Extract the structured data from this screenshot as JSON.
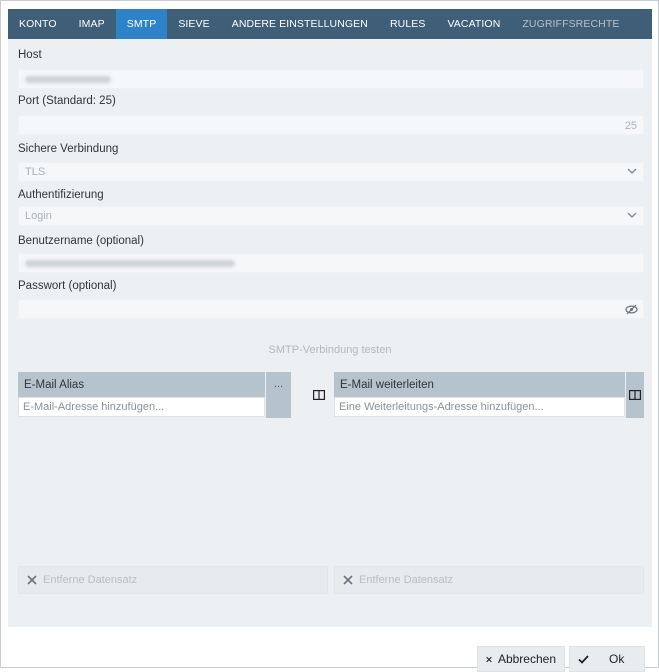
{
  "tabs": [
    {
      "label": "KONTO"
    },
    {
      "label": "IMAP"
    },
    {
      "label": "SMTP"
    },
    {
      "label": "SIEVE"
    },
    {
      "label": "ANDERE EINSTELLUNGEN"
    },
    {
      "label": "RULES"
    },
    {
      "label": "VACATION"
    },
    {
      "label": "ZUGRIFFSRECHTE"
    }
  ],
  "form": {
    "host_label": "Host",
    "port_label": "Port (Standard: 25)",
    "port_value": "25",
    "secure_label": "Sichere Verbindung",
    "secure_value": "TLS",
    "auth_label": "Authentifizierung",
    "auth_value": "Login",
    "user_label": "Benutzername (optional)",
    "pass_label": "Passwort (optional)",
    "test_button": "SMTP-Verbindung testen"
  },
  "alias_grid": {
    "header": "E-Mail Alias",
    "more": "...",
    "placeholder": "E-Mail-Adresse hinzufügen...",
    "delete_label": "Entferne Datensatz"
  },
  "forward_grid": {
    "header": "E-Mail weiterleiten",
    "placeholder": "Eine Weiterleitungs-Adresse hinzufügen...",
    "delete_label": "Entferne Datensatz"
  },
  "footer": {
    "cancel_label": "Abbrechen",
    "ok_label": "Ok"
  },
  "colors": {
    "tabbar": "#3f5e77",
    "active_tab": "#2d82c8",
    "panel": "#edf0f2",
    "grid_header": "#b7c3cc"
  },
  "icons": {
    "chevron": "chevron-down-icon",
    "eye": "eye-slash-icon",
    "columns": "columns-icon",
    "delete": "x-icon",
    "cancel": "x-icon",
    "ok": "check-icon"
  }
}
